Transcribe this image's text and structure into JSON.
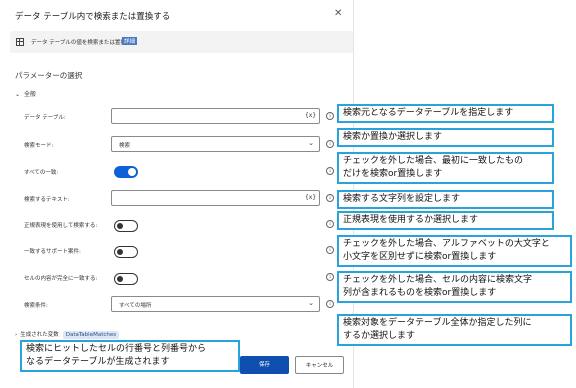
{
  "dialog": {
    "title": "データ テーブル内で検索または置換する",
    "close": "✕",
    "description": "データ テーブルの値を検索または置換する",
    "description_link": "詳細",
    "section_title": "パラメーターの選択",
    "group_title": "全般",
    "fields": {
      "datatable_label": "データ テーブル:",
      "datatable_var": "{x}",
      "mode_label": "検索モード:",
      "mode_value": "検索",
      "all_matches_label": "すべての一致:",
      "all_matches_on": true,
      "search_text_label": "検索するテキスト:",
      "search_text_var": "{x}",
      "regex_label": "正規表現を使用して検索する:",
      "regex_on": false,
      "match_case_label": "一致するサポート案件:",
      "match_case_on": false,
      "whole_cell_label": "セルの内容が完全に一致する:",
      "whole_cell_on": false,
      "search_condition_label": "検索条件:",
      "search_condition_value": "すべての場所"
    },
    "generated_vars_label": "生成された変数",
    "generated_vars_badge": "DataTableMatches",
    "save_label": "保存",
    "cancel_label": "キャンセル"
  },
  "callouts": {
    "c1": "検索元となるデータテーブルを指定します",
    "c2": "検索か置換か選択します",
    "c3_line1": "チェックを外した場合、最初に一致したもの",
    "c3_line2": "だけを検索or置換します",
    "c4": "検索する文字列を設定します",
    "c5": "正規表現を使用するか選択します",
    "c6_line1": "チェックを外した場合、アルファベットの大文字と",
    "c6_line2": "小文字を区別せずに検索or置換します",
    "c7_line1": "チェックを外した場合、セルの内容に検索文字",
    "c7_line2": "列が含まれるものを検索or置換します",
    "c8_line1": "検索対象をデータテーブル全体か指定した列に",
    "c8_line2": "するか選択します",
    "c9_line1": "検索にヒットしたセルの行番号と列番号から",
    "c9_line2": "なるデータテーブルが生成されます"
  }
}
